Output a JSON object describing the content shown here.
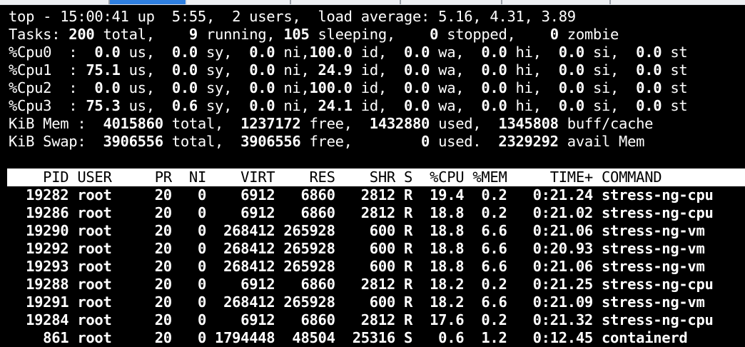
{
  "summary": {
    "top_line": "top - 15:00:41 up  5:55,  2 users,  load average: 5.16, 4.31, 3.89",
    "tasks": {
      "label": "Tasks:",
      "total": "200",
      "total_label": "total,",
      "running": "9",
      "running_label": "running,",
      "sleeping": "105",
      "sleeping_label": "sleeping,",
      "stopped": "0",
      "stopped_label": "stopped,",
      "zombie": "0",
      "zombie_label": "zombie"
    },
    "cpus": [
      {
        "label": "%Cpu0  :",
        "us": "0.0",
        "sy": "0.0",
        "ni": "0.0",
        "id": "100.0",
        "wa": "0.0",
        "hi": "0.0",
        "si": "0.0",
        "st": "0.0"
      },
      {
        "label": "%Cpu1  :",
        "us": "75.1",
        "sy": "0.0",
        "ni": "0.0",
        "id": "24.9",
        "wa": "0.0",
        "hi": "0.0",
        "si": "0.0",
        "st": "0.0"
      },
      {
        "label": "%Cpu2  :",
        "us": "0.0",
        "sy": "0.0",
        "ni": "0.0",
        "id": "100.0",
        "wa": "0.0",
        "hi": "0.0",
        "si": "0.0",
        "st": "0.0"
      },
      {
        "label": "%Cpu3  :",
        "us": "75.3",
        "sy": "0.6",
        "ni": "0.0",
        "id": "24.1",
        "wa": "0.0",
        "hi": "0.0",
        "si": "0.0",
        "st": "0.0"
      }
    ],
    "mem": {
      "label": "KiB Mem :",
      "total": "4015860",
      "free": "1237172",
      "used": "1432880",
      "buff_cache": "1345808"
    },
    "swap": {
      "label": "KiB Swap:",
      "total": "3906556",
      "free": "3906556",
      "used": "0",
      "avail_mem": "2329292"
    }
  },
  "table": {
    "headers": [
      "PID",
      "USER",
      "PR",
      "NI",
      "VIRT",
      "RES",
      "SHR",
      "S",
      "%CPU",
      "%MEM",
      "TIME+",
      "COMMAND"
    ],
    "rows": [
      [
        "19282",
        "root",
        "20",
        "0",
        "6912",
        "6860",
        "2812",
        "R",
        "19.4",
        "0.2",
        "0:21.24",
        "stress-ng-cpu"
      ],
      [
        "19286",
        "root",
        "20",
        "0",
        "6912",
        "6860",
        "2812",
        "R",
        "18.8",
        "0.2",
        "0:21.02",
        "stress-ng-cpu"
      ],
      [
        "19290",
        "root",
        "20",
        "0",
        "268412",
        "265928",
        "600",
        "R",
        "18.8",
        "6.6",
        "0:21.06",
        "stress-ng-vm"
      ],
      [
        "19292",
        "root",
        "20",
        "0",
        "268412",
        "265928",
        "600",
        "R",
        "18.8",
        "6.6",
        "0:20.93",
        "stress-ng-vm"
      ],
      [
        "19293",
        "root",
        "20",
        "0",
        "268412",
        "265928",
        "600",
        "R",
        "18.8",
        "6.6",
        "0:21.06",
        "stress-ng-vm"
      ],
      [
        "19288",
        "root",
        "20",
        "0",
        "6912",
        "6860",
        "2812",
        "R",
        "18.2",
        "0.2",
        "0:21.25",
        "stress-ng-cpu"
      ],
      [
        "19291",
        "root",
        "20",
        "0",
        "268412",
        "265928",
        "600",
        "R",
        "18.2",
        "6.6",
        "0:21.09",
        "stress-ng-vm"
      ],
      [
        "19284",
        "root",
        "20",
        "0",
        "6912",
        "6860",
        "2812",
        "R",
        "17.6",
        "0.2",
        "0:21.32",
        "stress-ng-cpu"
      ],
      [
        "861",
        "root",
        "20",
        "0",
        "1794448",
        "48504",
        "25316",
        "S",
        "0.6",
        "1.2",
        "0:12.45",
        "containerd"
      ]
    ]
  }
}
